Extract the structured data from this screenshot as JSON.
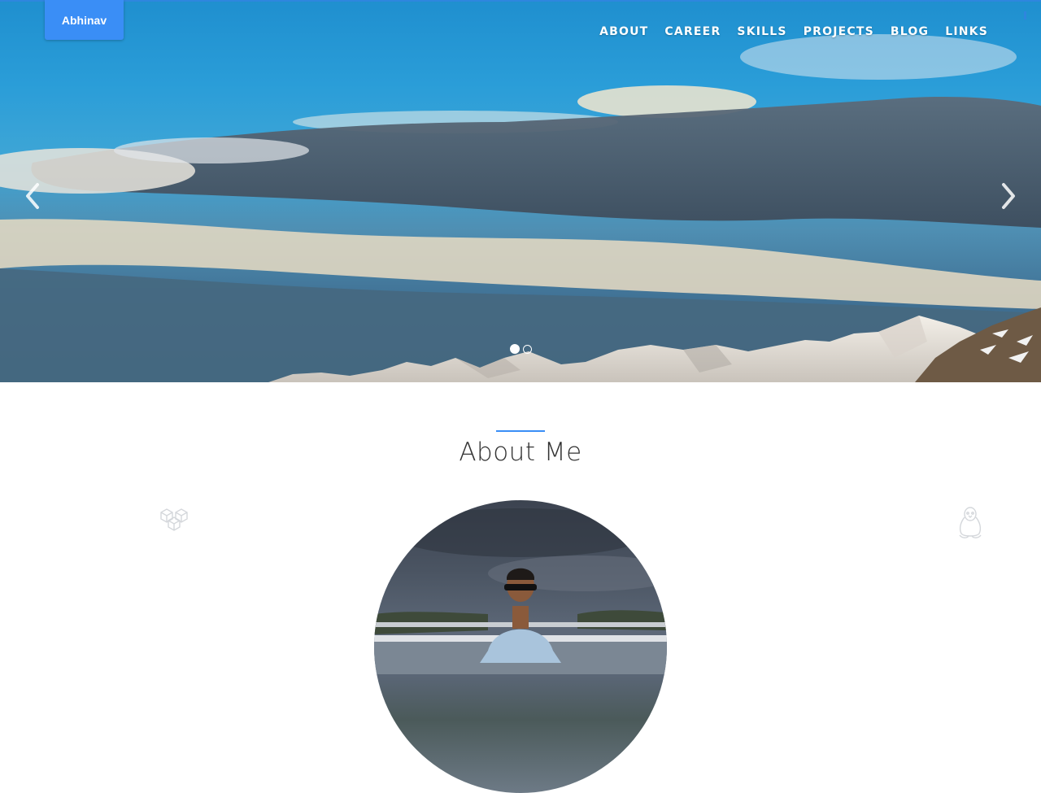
{
  "brand": {
    "label": "Abhinav"
  },
  "nav": {
    "items": [
      {
        "label": "ABOUT"
      },
      {
        "label": "CAREER"
      },
      {
        "label": "SKILLS"
      },
      {
        "label": "PROJECTS"
      },
      {
        "label": "BLOG"
      },
      {
        "label": "LINKS"
      }
    ]
  },
  "carousel": {
    "prev_icon": "chevron-left-icon",
    "next_icon": "chevron-right-icon",
    "slide_count": 2,
    "active_index": 0
  },
  "about": {
    "title": "About Me",
    "left_icon": "cubes-icon",
    "right_icon": "linux-penguin-icon"
  },
  "colors": {
    "accent": "#3a8ef6",
    "nav_text": "#ffffff",
    "title_text": "#333333"
  }
}
